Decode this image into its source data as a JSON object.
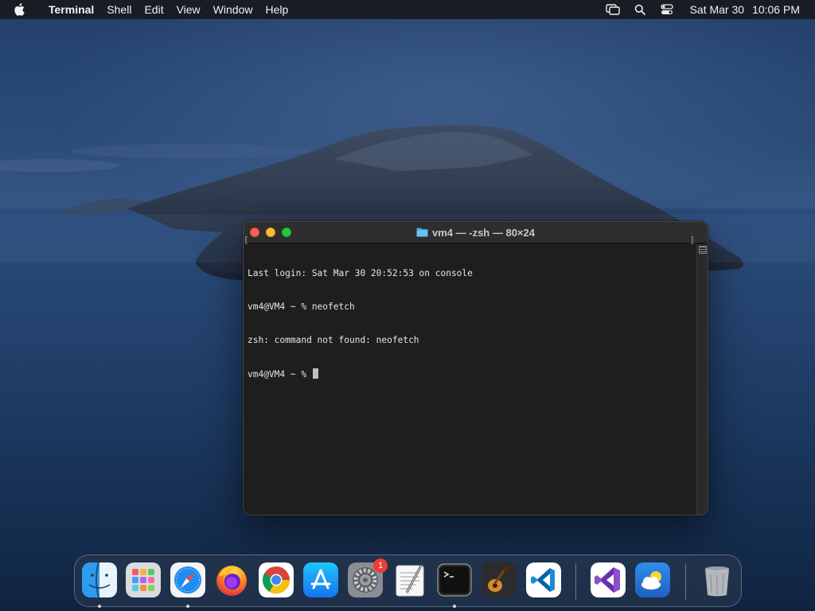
{
  "menubar": {
    "app_name": "Terminal",
    "menus": [
      "Shell",
      "Edit",
      "View",
      "Window",
      "Help"
    ],
    "status_icons": [
      "screen-mirroring-icon",
      "spotlight-search-icon",
      "control-center-icon"
    ],
    "date": "Sat Mar 30",
    "time": "10:06 PM"
  },
  "terminal": {
    "title": "vm4 — -zsh — 80×24",
    "lines": [
      "Last login: Sat Mar 30 20:52:53 on console",
      "vm4@VM4 ~ % neofetch",
      "zsh: command not found: neofetch",
      "vm4@VM4 ~ % "
    ],
    "bracket_left": "[",
    "bracket_right": "]"
  },
  "dock": {
    "apps": [
      {
        "name": "Finder",
        "icon": "finder-icon",
        "running": true
      },
      {
        "name": "Launchpad",
        "icon": "launchpad-icon",
        "running": false
      },
      {
        "name": "Safari",
        "icon": "safari-icon",
        "running": true
      },
      {
        "name": "Firefox",
        "icon": "firefox-icon",
        "running": false
      },
      {
        "name": "Google Chrome",
        "icon": "chrome-icon",
        "running": false
      },
      {
        "name": "App Store",
        "icon": "app-store-icon",
        "running": false
      },
      {
        "name": "System Preferences",
        "icon": "system-preferences-icon",
        "running": false,
        "badge": "1"
      },
      {
        "name": "TextEdit",
        "icon": "textedit-icon",
        "running": false
      },
      {
        "name": "Terminal",
        "icon": "terminal-icon",
        "running": true
      },
      {
        "name": "GarageBand",
        "icon": "garageband-icon",
        "running": false
      },
      {
        "name": "Visual Studio Code",
        "icon": "vscode-icon",
        "running": false
      },
      {
        "name": "Visual Studio",
        "icon": "visual-studio-icon",
        "running": false
      },
      {
        "name": "Weather",
        "icon": "weather-icon",
        "running": false
      },
      {
        "name": "Trash",
        "icon": "trash-icon",
        "running": false
      }
    ]
  },
  "colors": {
    "close": "#fe5f57",
    "minimize": "#febc2e",
    "maximize": "#28c840",
    "badge": "#ef3b36"
  }
}
